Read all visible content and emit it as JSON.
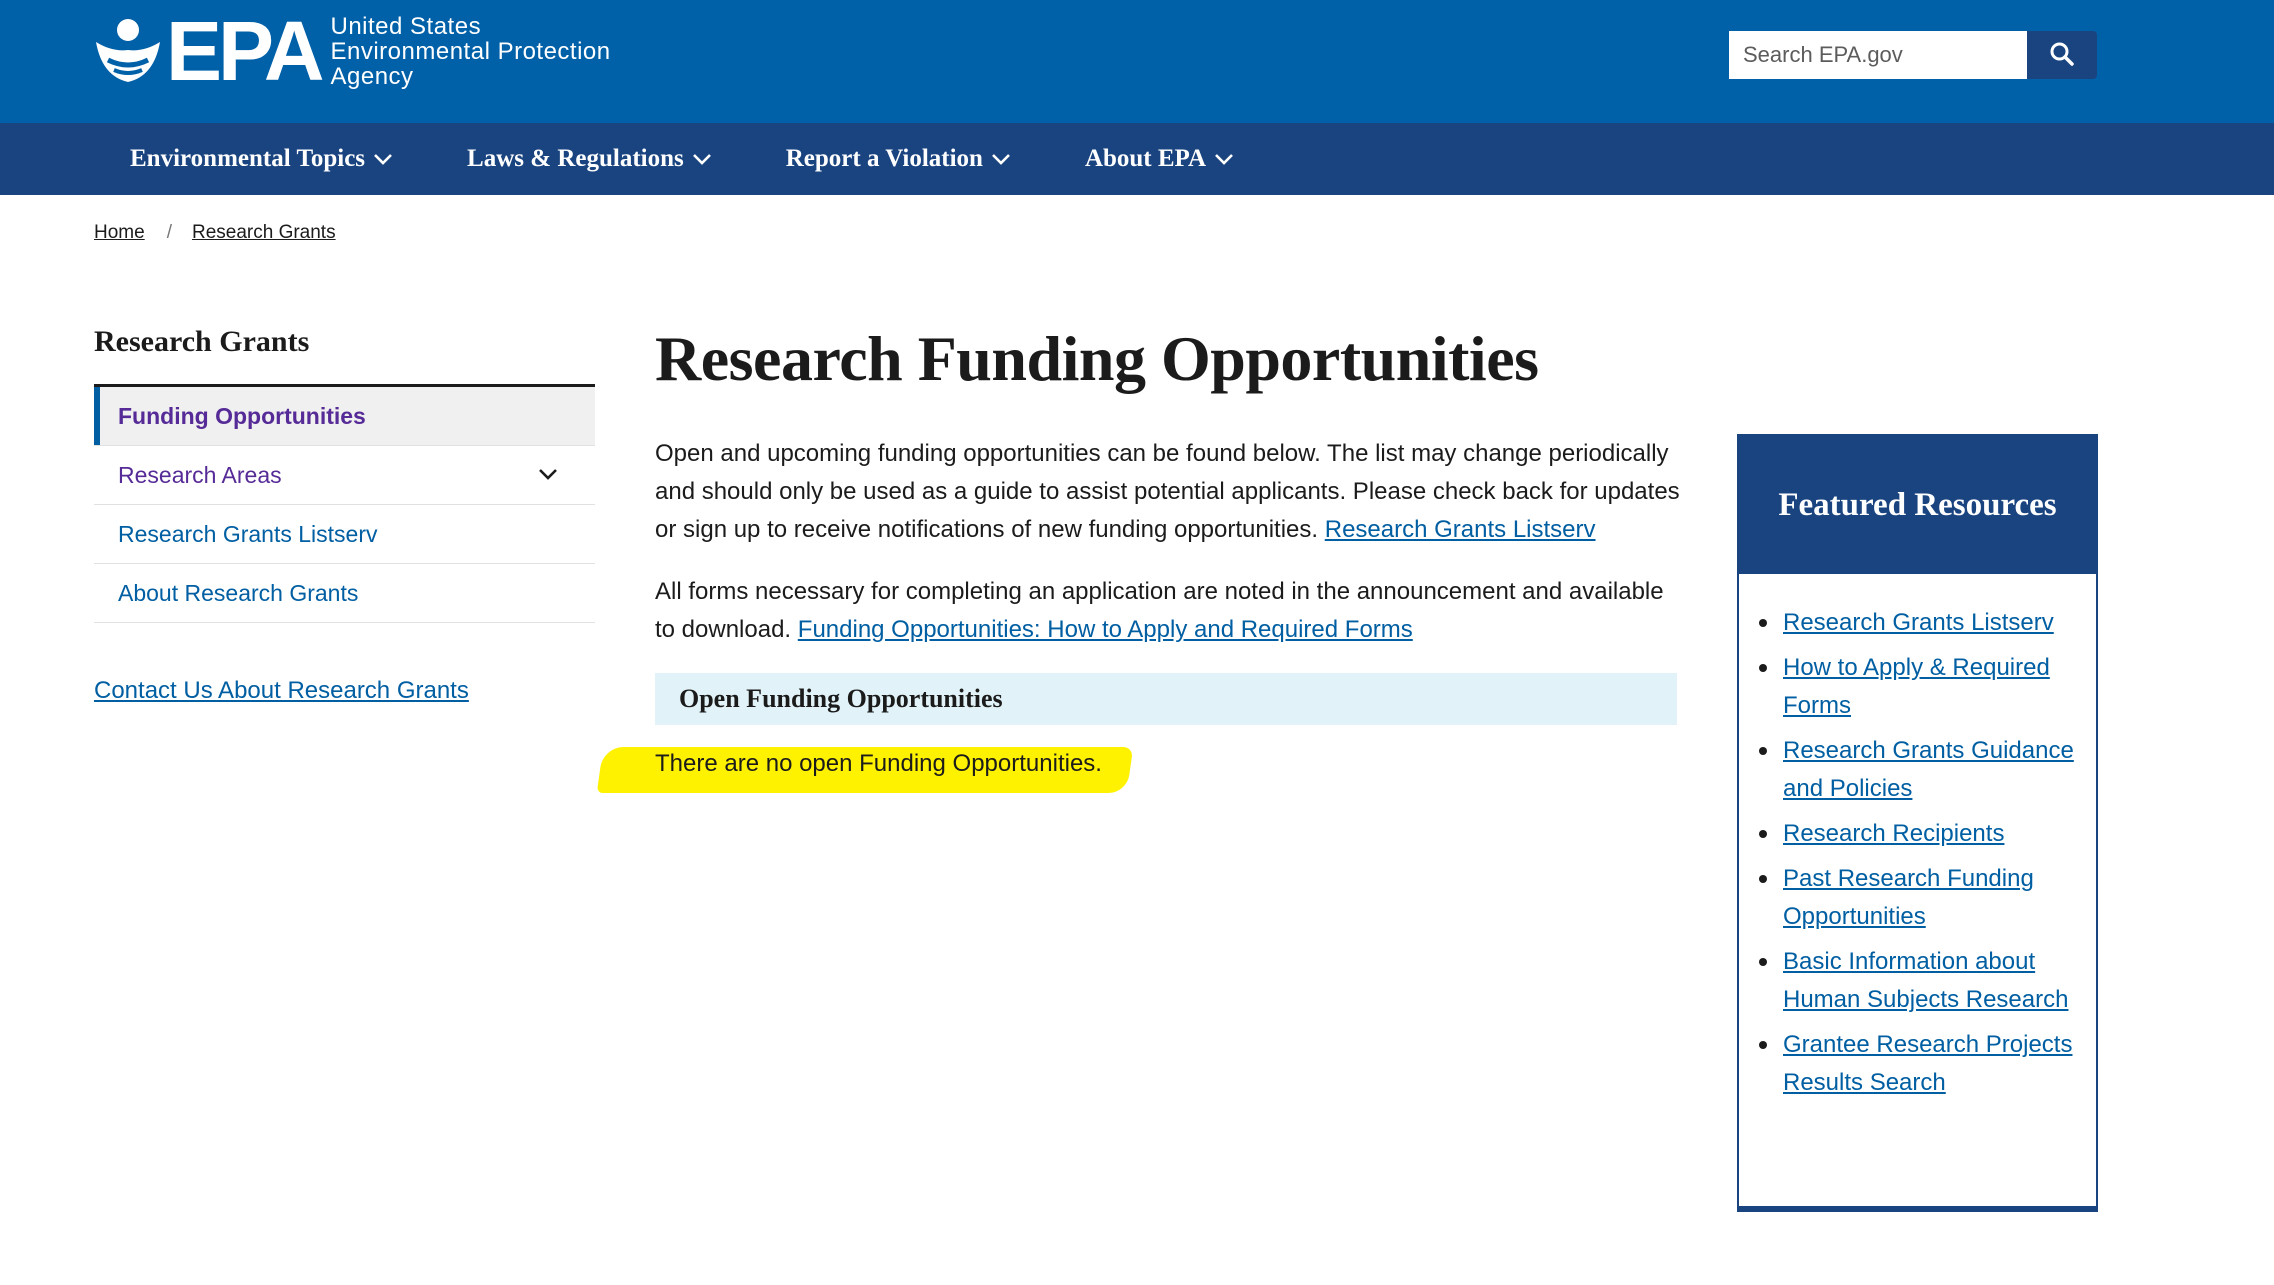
{
  "header": {
    "logo_text": "EPA",
    "agency_lines": [
      "United States",
      "Environmental Protection",
      "Agency"
    ],
    "search_placeholder": "Search EPA.gov",
    "brand_color": "#0060a8",
    "nav_color": "#1a4480"
  },
  "nav": {
    "items": [
      {
        "label": "Environmental Topics"
      },
      {
        "label": "Laws & Regulations"
      },
      {
        "label": "Report a Violation"
      },
      {
        "label": "About EPA"
      }
    ]
  },
  "breadcrumb": {
    "home": "Home",
    "separator": "/",
    "current": "Research Grants"
  },
  "sidebar": {
    "title": "Research Grants",
    "items": [
      {
        "label": "Funding Opportunities"
      },
      {
        "label": "Research Areas"
      },
      {
        "label": "Research Grants Listserv"
      },
      {
        "label": "About Research Grants"
      }
    ],
    "contact": "Contact Us About Research Grants"
  },
  "main": {
    "title": "Research Funding Opportunities",
    "para1_text": "Open and upcoming funding opportunities can be found below. The list may change periodically and should only be used as a guide to assist potential applicants. Please check back for updates or sign up to receive notifications of new funding opportunities.",
    "para1_link": "Research Grants Listserv",
    "para2_text": "All forms necessary for completing an application are noted in the announcement and available to download.",
    "para2_link": "Funding Opportunities: How to Apply and Required Forms",
    "open_heading": "Open Funding Opportunities",
    "no_open": "There are no open Funding Opportunities."
  },
  "featured": {
    "title": "Featured Resources",
    "items": [
      {
        "label": "Research Grants Listserv"
      },
      {
        "label": "How to Apply & Required Forms"
      },
      {
        "label": "Research Grants Guidance and Policies"
      },
      {
        "label": "Research Recipients"
      },
      {
        "label": "Past Research Funding Opportunities"
      },
      {
        "label": "Basic Information about Human Subjects Research"
      },
      {
        "label": "Grantee Research Projects Results Search"
      }
    ]
  }
}
